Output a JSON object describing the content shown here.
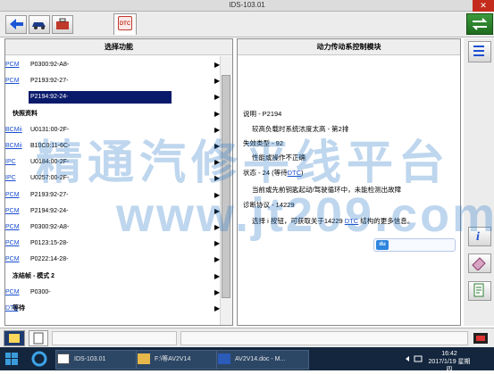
{
  "window": {
    "title": "IDS-103.01",
    "close_label": "✕"
  },
  "toolbar": {
    "tab_label": "DTC"
  },
  "left": {
    "header": "选择功能",
    "rows": [
      {
        "kind": "item",
        "text": "P0300:92-A8-",
        "link": "PCM",
        "arrow": "▶"
      },
      {
        "kind": "item",
        "text": "P2193:92-27-",
        "link": "PCM",
        "arrow": "▶"
      },
      {
        "kind": "item",
        "text": "P2194:92-24-",
        "link": "PCM",
        "arrow": "▶",
        "selected": true
      },
      {
        "kind": "section",
        "text": "快照资料",
        "arrow": "▶"
      },
      {
        "kind": "item",
        "text": "U0131:00-2F-",
        "link": "BCMii",
        "arrow": "▶"
      },
      {
        "kind": "item",
        "text": "B10C0:11-6C-",
        "link": "BCMii",
        "arrow": "▶"
      },
      {
        "kind": "item",
        "text": "U0184:00-2F-",
        "link": "IPC",
        "arrow": "▶"
      },
      {
        "kind": "item",
        "text": "U0257:00-2F-",
        "link": "IPC",
        "arrow": "▶"
      },
      {
        "kind": "item",
        "text": "P2193:92-27-",
        "link": "PCM",
        "arrow": "▶"
      },
      {
        "kind": "item",
        "text": "P2194:92-24-",
        "link": "PCM",
        "arrow": "▶"
      },
      {
        "kind": "item",
        "text": "P0300:92-A8-",
        "link": "PCM",
        "arrow": "▶"
      },
      {
        "kind": "item",
        "text": "P0123:15-28-",
        "link": "PCM",
        "arrow": "▶"
      },
      {
        "kind": "item",
        "text": "P0222:14-28-",
        "link": "PCM",
        "arrow": "▶"
      },
      {
        "kind": "section",
        "text": "冻结帧 - 模式 2",
        "arrow": "▶"
      },
      {
        "kind": "item",
        "text": "P0300-",
        "link": "PCM",
        "arrow": "▶"
      },
      {
        "kind": "section",
        "text": "等待",
        "link": "DTC",
        "arrow": "▶"
      }
    ]
  },
  "right": {
    "header": "动力传动系控制模块",
    "lines": [
      {
        "text": "说明 - P2194",
        "indent": false
      },
      {
        "text": "较高负载时系统浓度太高 - 第2排",
        "indent": true
      },
      {
        "text": "失效类型 - 92",
        "indent": false
      },
      {
        "text": "性能或操作不正确",
        "indent": true
      },
      {
        "text": "状态 - 24 (等待",
        "link": "DTC",
        "after": ")",
        "indent": false
      },
      {
        "text": "当前或先前钥匙起动/驾驶循环中，未能检测出故障",
        "indent": true
      },
      {
        "text": "诊断协议 - 14229",
        "indent": false
      },
      {
        "text": "选择 i 按钮，可获取关于14229 ",
        "link": "DTC",
        "after": " 结构的更多信息。",
        "indent": true
      }
    ],
    "du_label": "du"
  },
  "taskbar": {
    "items": [
      "IDS-103.01",
      "F:\\等AV2V14",
      "AV2V14.doc - M..."
    ],
    "time": "16:42",
    "date": "2017/1/19 星期四"
  },
  "watermark": {
    "line1": "精通汽修平线平台",
    "line2": "www.jt209.com"
  },
  "colors": {
    "selected_bg": "#0a1a6b",
    "link": "#1a4fd0",
    "taskbar": "#13263e",
    "close": "#c42b1c"
  }
}
